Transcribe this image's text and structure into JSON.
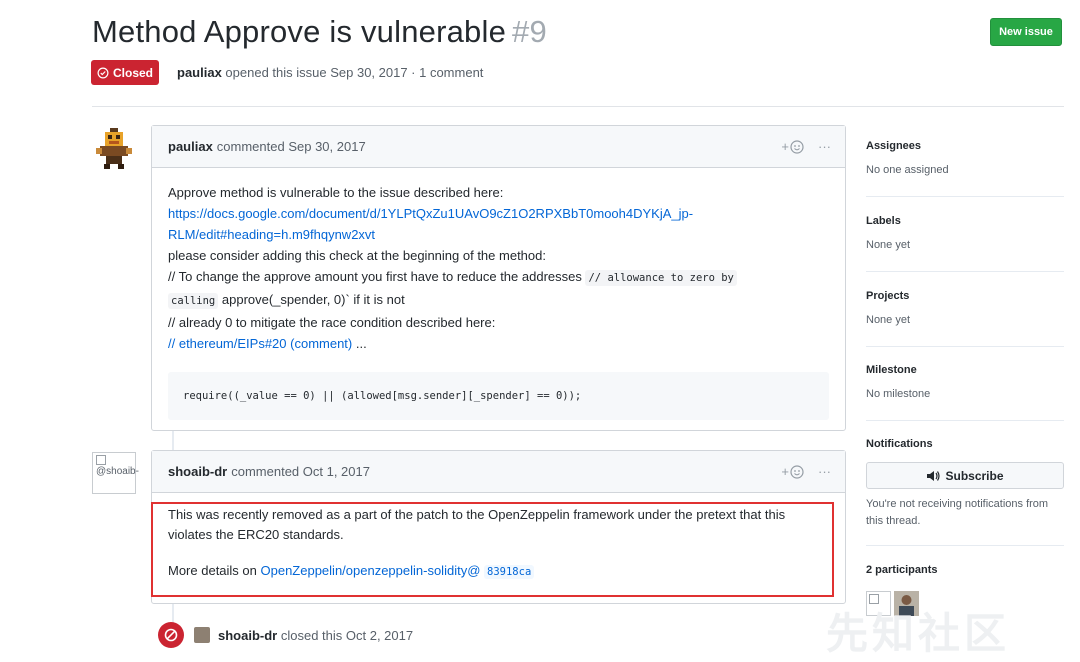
{
  "header": {
    "title": "Method Approve is vulnerable",
    "number": "#9",
    "new_issue_label": "New issue",
    "state_label": "Closed",
    "author": "pauliax",
    "meta_text": "opened this issue Sep 30, 2017 · 1 comment"
  },
  "comments": [
    {
      "author": "pauliax",
      "action": "commented Sep 30, 2017",
      "emoji_action": "+☺",
      "more": "···",
      "lines": {
        "l1": "Approve method is vulnerable to the issue described here:",
        "l2": "https://docs.google.com/document/d/1YLPtQxZu1UAvO9cZ1O2RPXBbT0mooh4DYKjA_jp-",
        "l3": "RLM/edit#heading=h.m9fhqynw2xvt",
        "l4": "please consider adding this check at the beginning of the method:",
        "l5a": "// To change the approve amount you first have to reduce the addresses",
        "l5b": "// allowance to zero by",
        "l6a": "calling",
        "l6b": "approve(_spender, 0)` if it is not",
        "l7": "// already 0 to mitigate the race condition described here:",
        "l8a": "// ",
        "l8b": "ethereum/EIPs#20 (comment)",
        "l8c": " ..."
      },
      "code": "require((_value == 0) || (allowed[msg.sender][_spender] == 0));"
    },
    {
      "author": "shoaib-dr",
      "avatar_alt": "@shoaib-",
      "action": "commented Oct 1, 2017",
      "emoji_action": "+☺",
      "more": "···",
      "p1": "This was recently removed as a part of the patch to the OpenZeppelin framework under the pretext that this violates the ERC20 standards.",
      "p2_prefix": "More details on ",
      "p2_link": "OpenZeppelin/openzeppelin-solidity@",
      "p2_sha": "83918ca"
    }
  ],
  "closed_event": {
    "actor": "shoaib-dr",
    "text": "closed this Oct 2, 2017"
  },
  "sidebar": {
    "assignees_label": "Assignees",
    "assignees_value": "No one assigned",
    "labels_label": "Labels",
    "labels_value": "None yet",
    "projects_label": "Projects",
    "projects_value": "None yet",
    "milestone_label": "Milestone",
    "milestone_value": "No milestone",
    "notifications_label": "Notifications",
    "subscribe_label": "Subscribe",
    "notifications_text": "You're not receiving notifications from this thread.",
    "participants_label": "2 participants"
  },
  "watermark": "先知社区",
  "colors": {
    "closed_red": "#cb2431",
    "new_issue_green": "#28a745",
    "link_blue": "#0366d6",
    "highlight_box": "#e03131"
  }
}
